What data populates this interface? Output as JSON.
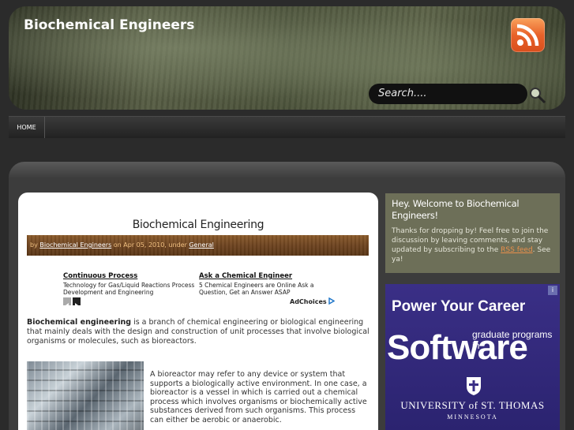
{
  "header": {
    "site_title": "Biochemical Engineers",
    "rss_icon": "rss-feed-icon",
    "search_placeholder": "Search....",
    "search_icon": "magnifier-icon"
  },
  "nav": {
    "items": [
      {
        "label": "HOME"
      }
    ]
  },
  "post": {
    "title": "Biochemical Engineering",
    "meta": {
      "by": "by",
      "author": "Biochemical Engineers",
      "on": "on Apr 05, 2010, under",
      "category": "General"
    },
    "ads": [
      {
        "title": "Continuous Process",
        "text": "Technology for Gas/Liquid Reactions Process Development and Engineering"
      },
      {
        "title": "Ask a Chemical Engineer",
        "text": "5 Chemical Engineers are Online Ask a Question, Get an Answer ASAP"
      }
    ],
    "adchoices": "AdChoices",
    "para1_bold": "Biochemical engineering",
    "para1_rest": " is a branch of chemical engineering or biological engineering that mainly deals with the design and construction of unit processes that involve biological organisms or molecules, such as bioreactors.",
    "para2": "A bioreactor may refer to any device or system that supports a biologically active environment. In one case, a bioreactor is a vessel in which is carried out a chemical process which involves organisms or biochemically active substances derived from such organisms. This process can either be aerobic or anaerobic."
  },
  "sidebar": {
    "welcome_title": "Hey. Welcome to Biochemical Engineers!",
    "welcome_text_before": "Thanks for dropping by! Feel free to join the discussion by leaving comments, and stay updated by subscribing to the ",
    "welcome_link": "RSS feed",
    "welcome_text_after": ". See ya!",
    "banner": {
      "headline": "Power Your Career",
      "sub": "graduate programs in",
      "big": "Software",
      "university": "UNIVERSITY of ST. THOMAS",
      "state": "MINNESOTA"
    }
  },
  "colors": {
    "accent_orange": "#e88f4b",
    "banner_purple": "#3a2f86",
    "welcome_olive": "#6d6f58"
  }
}
